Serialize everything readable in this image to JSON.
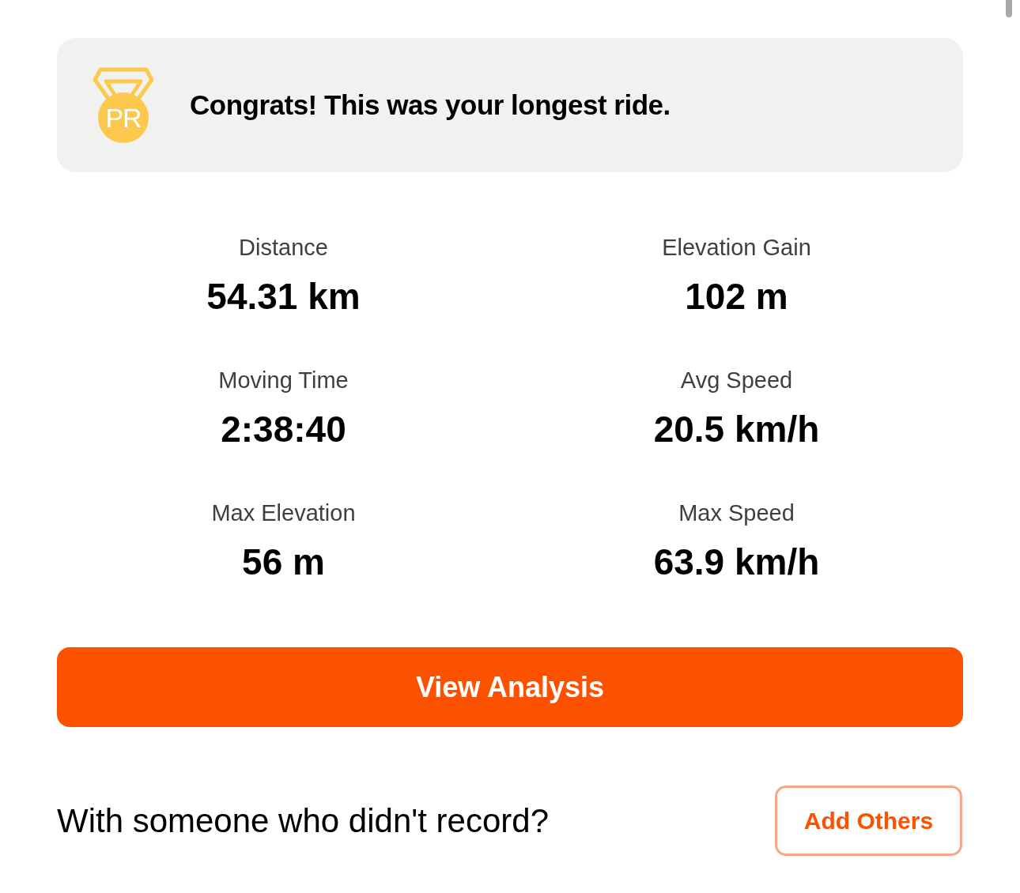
{
  "achievement": {
    "badge": "PR",
    "message": "Congrats! This was your longest ride."
  },
  "stats": [
    {
      "label": "Distance",
      "value": "54.31 km"
    },
    {
      "label": "Elevation Gain",
      "value": "102 m"
    },
    {
      "label": "Moving Time",
      "value": "2:38:40"
    },
    {
      "label": "Avg Speed",
      "value": "20.5 km/h"
    },
    {
      "label": "Max Elevation",
      "value": "56 m"
    },
    {
      "label": "Max Speed",
      "value": "63.9 km/h"
    }
  ],
  "primary_button": {
    "label": "View Analysis"
  },
  "add_others": {
    "prompt": "With someone who didn't record?",
    "button": "Add Others"
  }
}
